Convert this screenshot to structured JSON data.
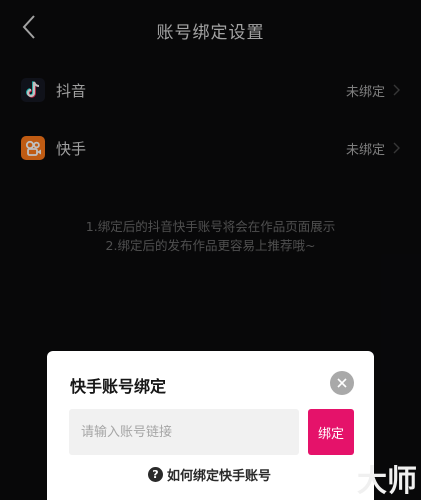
{
  "header": {
    "title": "账号绑定设置"
  },
  "accounts": [
    {
      "name": "抖音",
      "status": "未绑定",
      "icon": "douyin-icon"
    },
    {
      "name": "快手",
      "status": "未绑定",
      "icon": "kuaishou-icon"
    }
  ],
  "note": {
    "line1": "1.绑定后的抖音快手账号将会在作品页面展示",
    "line2": "2.绑定后的发布作品更容易上推荐哦~"
  },
  "dialog": {
    "title": "快手账号绑定",
    "input_placeholder": "请输入账号链接",
    "bind_label": "绑定",
    "help_text": "如何绑定快手账号",
    "accent": "#e5126a"
  },
  "watermark": "大师"
}
